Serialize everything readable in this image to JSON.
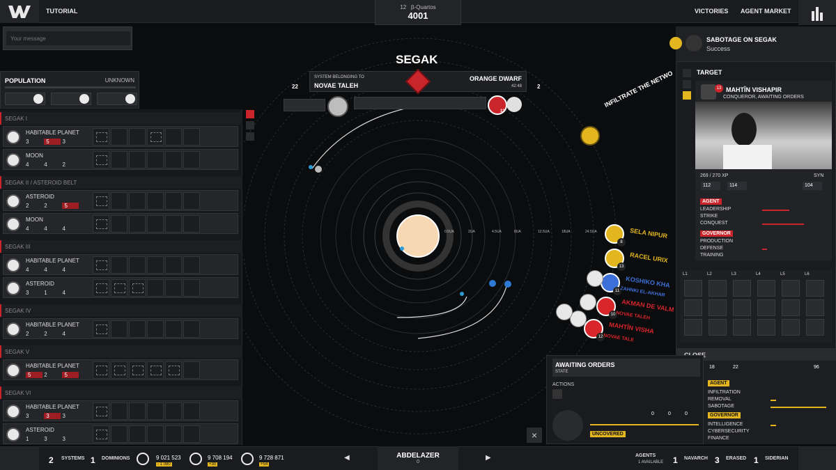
{
  "topbar": {
    "tutorial": "TUTORIAL",
    "date_num": "12",
    "date_unit": "β-Quartos",
    "year": "4001",
    "victories": "VICTORIES",
    "agent_market": "AGENT MARKET"
  },
  "message": {
    "placeholder": "Your message"
  },
  "population": {
    "title": "POPULATION",
    "status": "UNKNOWN"
  },
  "systems": [
    {
      "name": "SEGAK I",
      "type": "",
      "bodies": [
        {
          "label": "HABITABLE PLANET",
          "a": "3",
          "b": "5",
          "c": "3",
          "b_alert": true
        },
        {
          "label": "MOON",
          "a": "4",
          "b": "4",
          "c": "2",
          "b_alert": false
        }
      ]
    },
    {
      "name": "SEGAK II",
      "type": "/ ASTEROID BELT",
      "bodies": [
        {
          "label": "ASTEROID",
          "a": "2",
          "b": "2",
          "c": "5",
          "c_alert": true
        },
        {
          "label": "MOON",
          "a": "4",
          "b": "4",
          "c": "4"
        }
      ]
    },
    {
      "name": "SEGAK III",
      "type": "",
      "bodies": [
        {
          "label": "HABITABLE PLANET",
          "a": "4",
          "b": "4",
          "c": "4"
        },
        {
          "label": "ASTEROID",
          "a": "3",
          "b": "1",
          "c": "4"
        }
      ]
    },
    {
      "name": "SEGAK IV",
      "type": "",
      "bodies": [
        {
          "label": "HABITABLE PLANET",
          "a": "2",
          "b": "2",
          "c": "4"
        }
      ]
    },
    {
      "name": "SEGAK V",
      "type": "",
      "bodies": [
        {
          "label": "HABITABLE PLANET",
          "a": "5",
          "b": "2",
          "c": "5",
          "a_alert": true,
          "c_alert": true
        }
      ]
    },
    {
      "name": "SEGAK VI",
      "type": "",
      "bodies": [
        {
          "label": "HABITABLE PLANET",
          "a": "3",
          "b": "3",
          "c": "3",
          "b_alert": true
        },
        {
          "label": "ASTEROID",
          "a": "1",
          "b": "3",
          "c": "3"
        }
      ]
    }
  ],
  "map": {
    "system_name": "SEGAK",
    "belonging_label": "SYSTEM BELONGING TO",
    "owner": "NOVAE TALEH",
    "star_type": "ORANGE DWARF",
    "time": "42:48",
    "left_count": "22",
    "right_count": "2",
    "fleet_count": "13",
    "distance_labels": [
      "0.5UA",
      "2UA",
      "4.5UA",
      "8UA",
      "12.5UA",
      "18UA",
      "24.5UA"
    ],
    "infiltrate": "INFILTRATE THE NETWO"
  },
  "agents_on_map": [
    {
      "name": "SELA NIPUR",
      "sub": "",
      "color": "#e3b620",
      "level": "8"
    },
    {
      "name": "RACEL URIX",
      "sub": "",
      "color": "#e3b620",
      "level": "13"
    },
    {
      "name": "KOSHIKO KHA",
      "sub": "ZAHNKI EL-AKHAR",
      "color": "#3d6fd8",
      "level": "11"
    },
    {
      "name": "AKMAN DE VALM",
      "sub": "NOVAE TALEH",
      "color": "#d8262b",
      "level": "10"
    },
    {
      "name": "MAHTÎN VISHA",
      "sub": "NOVAE TALE",
      "color": "#d8262b",
      "level": "12"
    }
  ],
  "mission": {
    "title": "SABOTAGE ON SEGAK",
    "status": "Success"
  },
  "target_panel": {
    "title": "TARGET",
    "agent_name": "MAHTÎN VISHAPIR",
    "agent_state": "CONQUEROR, AWAITING ORDERS",
    "level": "13",
    "xp": "269 / 270 XP",
    "syn": "SYN",
    "stat1": "112",
    "stat2": "114",
    "stat3": "104",
    "agent_tag": "AGENT",
    "governor_tag": "GOVERNOR",
    "agent_skills": [
      "LEADERSHIP",
      "STRIKE",
      "CONQUEST"
    ],
    "agent_skill_levels": [
      0.55,
      0.0,
      0.85
    ],
    "gov_skills": [
      "PRODUCTION",
      "DEFENSE",
      "TRAINING"
    ],
    "gov_skill_levels": [
      0.0,
      0.1,
      0.0
    ],
    "grid_headers": [
      "L1",
      "L2",
      "L3",
      "L4",
      "L5",
      "L6"
    ],
    "close": "CLOSE"
  },
  "orders_panel": {
    "title": "AWAITING ORDERS",
    "state": "STATE",
    "actions": "ACTIONS",
    "uncovered": "UNCOVERED",
    "c1": "0",
    "c2": "0",
    "c3": "0"
  },
  "own_agent": {
    "s1": "18",
    "s2": "22",
    "s3": "96",
    "agent_tag": "AGENT",
    "governor_tag": "GOVERNOR",
    "agent_skills": [
      "INFILTRATION",
      "REMOVAL",
      "SABOTAGE"
    ],
    "agent_skill_levels": [
      0.0,
      0.1,
      1.0
    ],
    "gov_skills": [
      "INTELLIGENCE",
      "CYBERSECURITY",
      "FINANCE"
    ],
    "gov_skill_levels": [
      0.1,
      0.0,
      0.0
    ]
  },
  "bottombar": {
    "systems_num": "2",
    "systems": "SYSTEMS",
    "dominions_num": "1",
    "dominions": "DOMINIONS",
    "res1": "9 021 523",
    "res1_delta": "- 1 080",
    "res2": "9 708 194",
    "res2_delta": "+30",
    "res3": "9 728 871",
    "res3_delta": "+54",
    "player": "ABDELAZER",
    "player_count": "0",
    "agents": "AGENTS",
    "agents_avail": "1 AVAILABLE",
    "navarch_num": "1",
    "navarch": "NAVARCH",
    "erased_num": "3",
    "erased": "ERASED",
    "siderian_num": "1",
    "siderian": "SIDERIAN"
  }
}
